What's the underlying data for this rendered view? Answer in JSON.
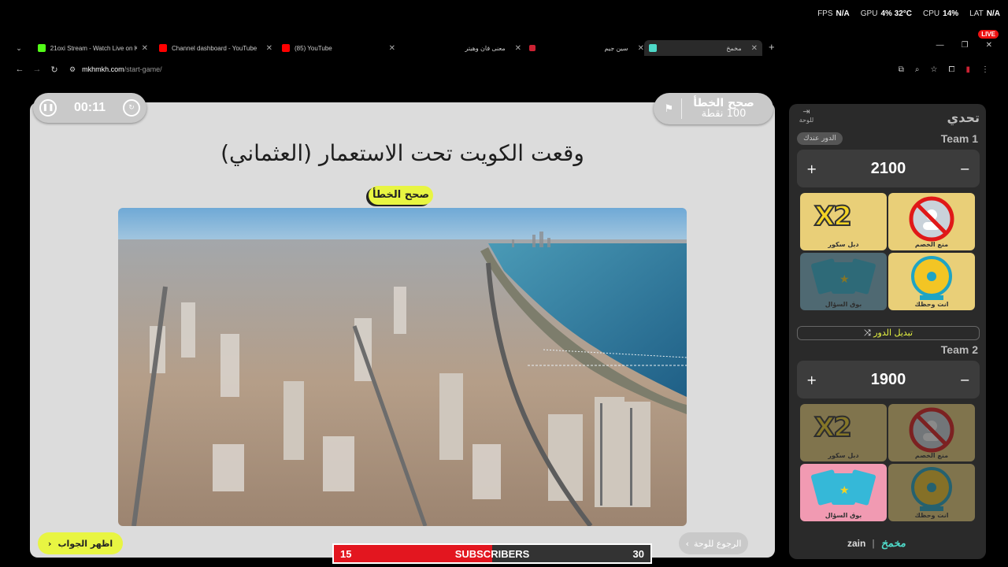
{
  "overlay": {
    "fps_label": "FPS",
    "fps_value": "N/A",
    "gpu_label": "GPU",
    "gpu_value": "4% 32°C",
    "cpu_label": "CPU",
    "cpu_value": "14%",
    "lat_label": "LAT",
    "lat_value": "N/A",
    "live": "LIVE"
  },
  "browser": {
    "tabs": [
      {
        "label": "21oxi Stream - Watch Live on K",
        "icon": "kick-icon",
        "color": "#53fc18"
      },
      {
        "label": "Channel dashboard - YouTube",
        "icon": "youtube-icon",
        "color": "#ff0000"
      },
      {
        "label": "(85) YouTube",
        "icon": "youtube-icon",
        "color": "#ff0000"
      },
      {
        "label": "معنى فان وهيتر",
        "icon": "none",
        "color": "#444"
      },
      {
        "label": "سين جيم",
        "icon": "none",
        "color": "#444"
      },
      {
        "label": "مخمخ",
        "icon": "mkhmkh-icon",
        "color": "#4ed9c8"
      }
    ],
    "url_host": "mkhmkh.com",
    "url_path": "/start-game/"
  },
  "game": {
    "timer": "00:11",
    "category_name": "صحح الخطأ",
    "category_points": "100 نقطة",
    "question": "وقعت الكويت تحت الاستعمار (العثماني)",
    "question_type": "صحح الخطأ",
    "show_answer": "اظهر الجواب",
    "back_to_board": "الرجوع للوحة"
  },
  "panel": {
    "title": "تحدي",
    "exit_label": "للوحة",
    "turn_label": "الدور عندك",
    "switch_turn": "تبديل الدور",
    "teams": [
      {
        "name": "Team 1",
        "score": "2100"
      },
      {
        "name": "Team 2",
        "score": "1900"
      }
    ],
    "cards": {
      "double": "دبل سكور",
      "block": "منع الخصم",
      "cards": "بوق السؤال",
      "wheel": "انت وحظك"
    },
    "brand_zain": "zain",
    "brand_mk": "مخمخ"
  },
  "subscribers": {
    "current": "15",
    "label": "SUBSCRIBERS",
    "goal": "30",
    "progress": 0.5
  }
}
